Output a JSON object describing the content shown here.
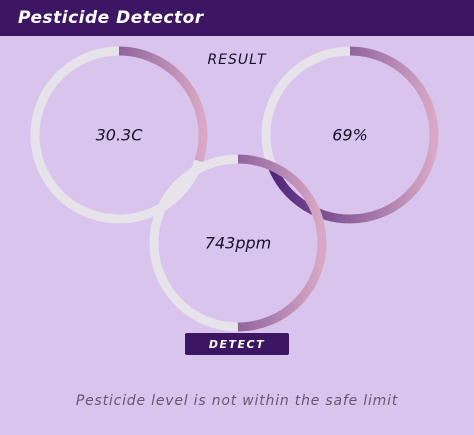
{
  "app": {
    "title": "Pesticide Detector"
  },
  "result": {
    "title": "RESULT"
  },
  "colors": {
    "app_bar": "#3c1663",
    "background": "#d9c4ee",
    "track": "#e6e3ea",
    "arc_start": "#4a1f78",
    "arc_end": "#d8a8c4"
  },
  "gauges": [
    {
      "label": "30.3C",
      "progress": 0.3
    },
    {
      "label": "69%",
      "progress": 0.69
    },
    {
      "label": "743ppm",
      "progress": 0.5
    }
  ],
  "detect": {
    "label": "DETECT"
  },
  "status": {
    "message": "Pesticide level is not within the safe limit"
  }
}
